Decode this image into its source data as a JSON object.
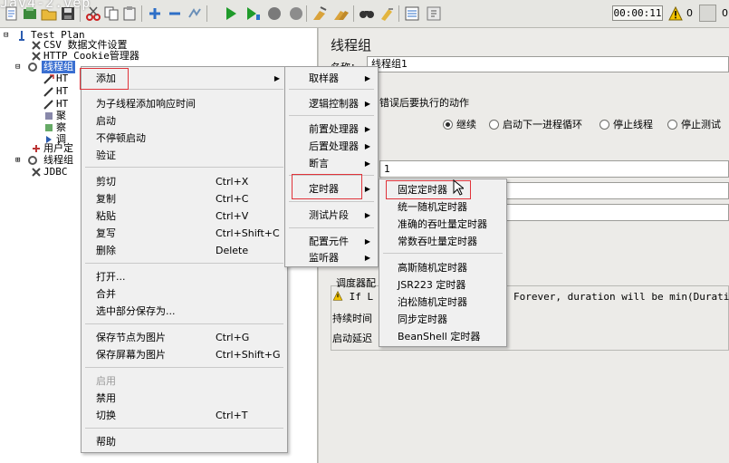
{
  "window": {
    "title_fragment": "Jav4-2.vep"
  },
  "toolbar": {
    "icons": [
      "new-icon",
      "template-icon",
      "open-icon",
      "save-icon",
      "cut-icon",
      "copy-icon",
      "paste-icon",
      "expand-icon",
      "collapse-icon",
      "toggle-icon",
      "start-icon",
      "start-no-pause-icon",
      "stop-icon",
      "shutdown-icon",
      "clear-icon",
      "clear-all-icon",
      "search-icon",
      "reset-search-icon",
      "function-helper-icon",
      "help-icon"
    ],
    "timer": "00:00:11",
    "warning_count": "0",
    "right_count": "0"
  },
  "tree": {
    "items": [
      {
        "label": "Test Plan"
      },
      {
        "label": "CSV 数据文件设置"
      },
      {
        "label": "HTTP Cookie管理器"
      },
      {
        "label": "线程组"
      },
      {
        "label": "HT"
      },
      {
        "label": "HT"
      },
      {
        "label": "HT"
      },
      {
        "label": "聚"
      },
      {
        "label": "察"
      },
      {
        "label": "调"
      },
      {
        "label": "用户定"
      },
      {
        "label": "线程组"
      },
      {
        "label": "JDBC"
      }
    ]
  },
  "context_menu": {
    "items": [
      {
        "label": "添加",
        "shortcut": "",
        "submenu": true
      },
      {
        "label": "为子线程添加响应时间",
        "shortcut": ""
      },
      {
        "label": "启动",
        "shortcut": ""
      },
      {
        "label": "不停顿启动",
        "shortcut": ""
      },
      {
        "label": "验证",
        "shortcut": ""
      },
      {
        "label": "剪切",
        "shortcut": "Ctrl+X"
      },
      {
        "label": "复制",
        "shortcut": "Ctrl+C"
      },
      {
        "label": "粘贴",
        "shortcut": "Ctrl+V"
      },
      {
        "label": "复写",
        "shortcut": "Ctrl+Shift+C"
      },
      {
        "label": "删除",
        "shortcut": "Delete"
      },
      {
        "label": "打开...",
        "shortcut": ""
      },
      {
        "label": "合并",
        "shortcut": ""
      },
      {
        "label": "选中部分保存为...",
        "shortcut": ""
      },
      {
        "label": "保存节点为图片",
        "shortcut": "Ctrl+G"
      },
      {
        "label": "保存屏幕为图片",
        "shortcut": "Ctrl+Shift+G"
      },
      {
        "label": "启用",
        "shortcut": "",
        "disabled": true
      },
      {
        "label": "禁用",
        "shortcut": ""
      },
      {
        "label": "切换",
        "shortcut": "Ctrl+T"
      },
      {
        "label": "帮助",
        "shortcut": ""
      }
    ]
  },
  "add_submenu": {
    "items": [
      {
        "label": "取样器"
      },
      {
        "label": "逻辑控制器"
      },
      {
        "label": "前置处理器"
      },
      {
        "label": "后置处理器"
      },
      {
        "label": "断言"
      },
      {
        "label": "定时器"
      },
      {
        "label": "测试片段"
      },
      {
        "label": "配置元件"
      },
      {
        "label": "监听器"
      }
    ]
  },
  "timer_submenu": {
    "items": [
      {
        "label": "固定定时器"
      },
      {
        "label": "统一随机定时器"
      },
      {
        "label": "准确的吞吐量定时器"
      },
      {
        "label": "常数吞吐量定时器"
      },
      {
        "label": "高斯随机定时器"
      },
      {
        "label": "JSR223 定时器"
      },
      {
        "label": "泊松随机定时器"
      },
      {
        "label": "同步定时器"
      },
      {
        "label": "BeanShell 定时器"
      }
    ]
  },
  "right_panel": {
    "title": "线程组",
    "name_label": "名称：",
    "name_value": "线程组1",
    "error_action_title": "错误后要执行的动作",
    "radios": [
      {
        "label": "继续",
        "checked": true
      },
      {
        "label": "启动下一进程循环",
        "checked": false
      },
      {
        "label": "停止线程",
        "checked": false
      },
      {
        "label": "停止测试",
        "checked": false
      }
    ],
    "threads_value": "1",
    "scheduler_title": "调度器配",
    "scheduler_warning": "If L",
    "scheduler_warning_tail": "Forever, duration will be min(Duration,",
    "duration_label": "持续时间",
    "delay_label": "启动延迟"
  }
}
